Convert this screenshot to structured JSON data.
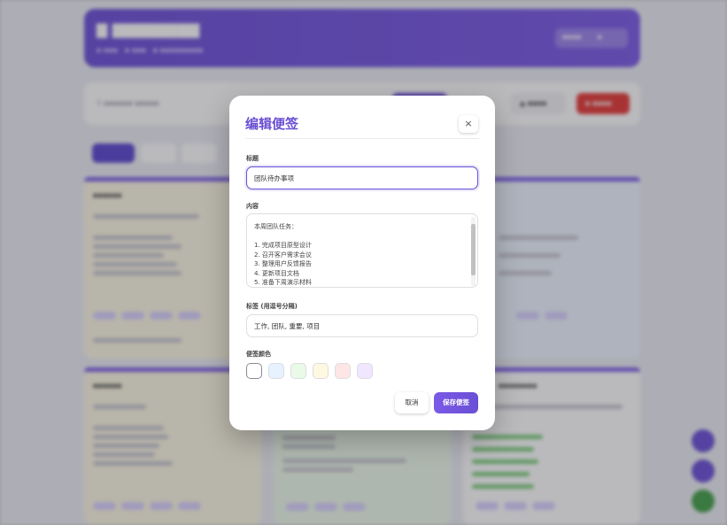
{
  "modal": {
    "title": "编辑便签",
    "close_glyph": "×",
    "title_label": "标题",
    "title_value": "团队待办事项",
    "content_label": "内容",
    "content_lines": [
      "本周团队任务：",
      "",
      "1. 完成项目原型设计",
      "2. 召开客户需求会议",
      "3. 整理用户反馈报告",
      "4. 更新项目文档",
      "5. 准备下周演示材料"
    ],
    "tags_label": "标签 (用逗号分隔)",
    "tags_value": "工作, 团队, 重要, 项目",
    "color_label": "便签颜色",
    "colors": [
      "#ffffff",
      "#e6f2ff",
      "#e9fbe6",
      "#fff8e1",
      "#ffe6e6",
      "#f1e6ff"
    ],
    "selected_color_index": 0,
    "cancel_label": "取消",
    "save_label": "保存便签"
  },
  "colors": {
    "accent": "#6b4fd6",
    "header_gradient_start": "#6b4fd6",
    "danger": "#e53935",
    "fab_green": "#43a047"
  }
}
